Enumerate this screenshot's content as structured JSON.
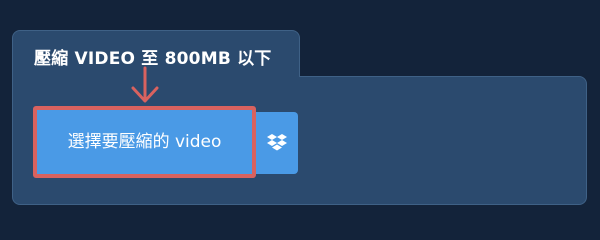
{
  "tab": {
    "title": "壓縮 VIDEO 至 800MB 以下"
  },
  "upload": {
    "button_label": "選擇要壓縮的 video"
  },
  "icons": {
    "arrow": "arrow-down-icon",
    "dropbox": "dropbox-icon"
  },
  "colors": {
    "background": "#13233a",
    "panel": "#2b4a6e",
    "button": "#4a9ae6",
    "highlight": "#d9625f"
  }
}
